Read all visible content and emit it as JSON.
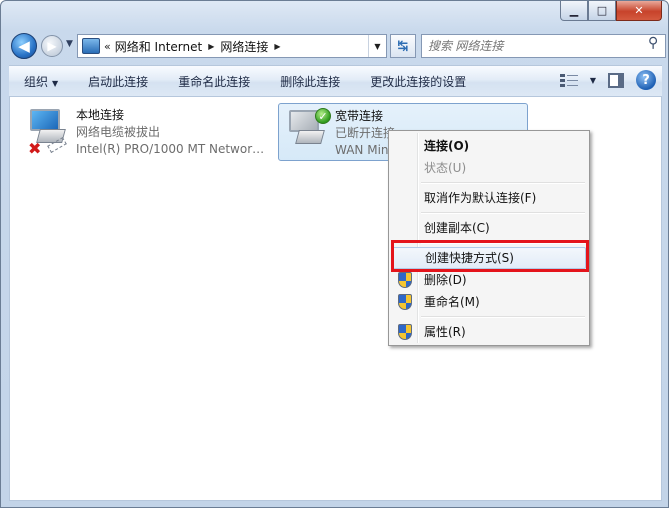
{
  "window": {
    "minimize_glyph": "▁",
    "maximize_glyph": "□",
    "close_glyph": "✕"
  },
  "navigation": {
    "back_glyph": "◀",
    "forward_glyph": "▶",
    "history_glyph": "▼",
    "breadcrumb_prefix": "«",
    "breadcrumbs": [
      "网络和 Internet",
      "网络连接"
    ],
    "crumb_arrow": "▶",
    "refresh_glyph": "↹",
    "search_placeholder": "搜索 网络连接"
  },
  "toolbar": {
    "organize": "组织",
    "enable": "启动此连接",
    "rename": "重命名此连接",
    "delete": "删除此连接",
    "change_settings": "更改此连接的设置",
    "help_glyph": "?"
  },
  "connections": [
    {
      "name": "本地连接",
      "status": "网络电缆被拔出",
      "device": "Intel(R) PRO/1000 MT Networ…",
      "status_glyph": "✖"
    },
    {
      "name": "宽带连接",
      "status": "已断开连接",
      "device": "WAN Min",
      "status_glyph": "✓"
    }
  ],
  "context_menu": {
    "connect": "连接(O)",
    "status": "状态(U)",
    "cancel_default": "取消作为默认连接(F)",
    "create_copy": "创建副本(C)",
    "create_shortcut": "创建快捷方式(S)",
    "delete": "删除(D)",
    "rename": "重命名(M)",
    "properties": "属性(R)"
  },
  "colors": {
    "highlight_box": "#e4141b",
    "selection": "#d6e9f8",
    "menu_background": "#f5f5f5"
  }
}
